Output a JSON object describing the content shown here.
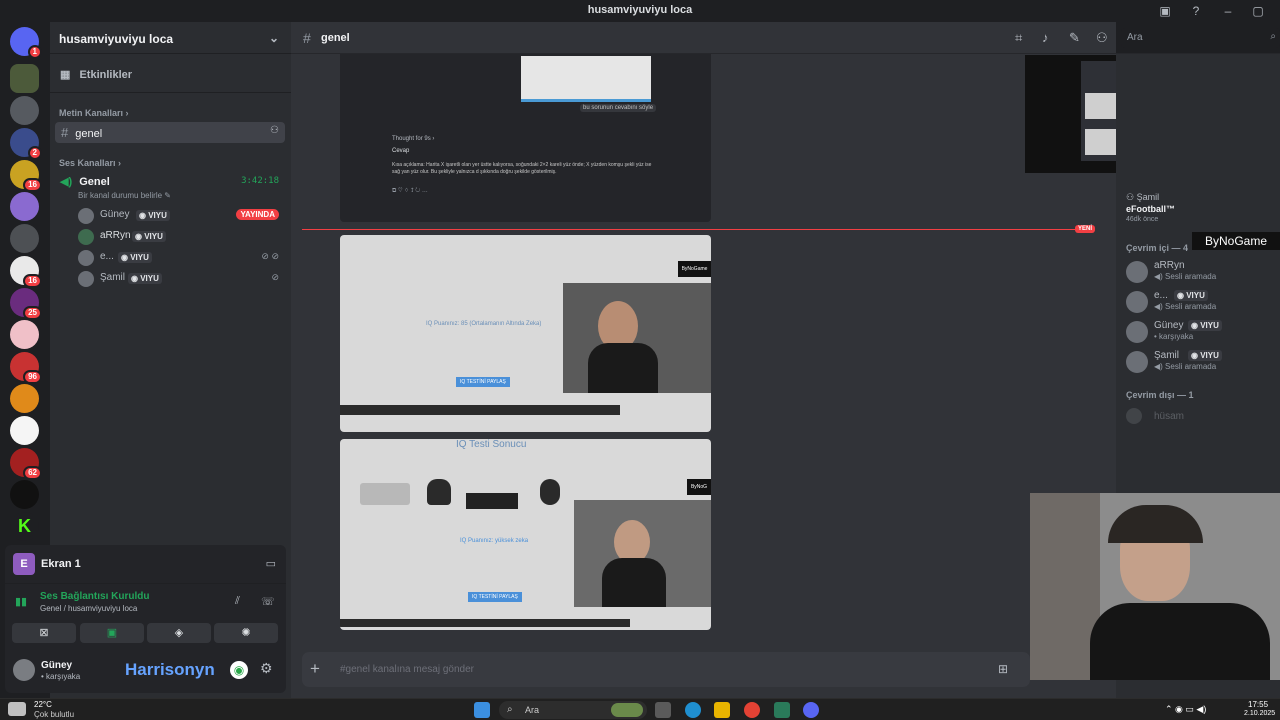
{
  "window": {
    "title": "husamviyuviyu loca"
  },
  "server": {
    "name": "husamviyuviyu loca",
    "events_label": "Etkinlikler",
    "text_category": "Metin Kanalları",
    "text_channel": "genel",
    "voice_category": "Ses Kanalları",
    "voice_channel": "Genel",
    "voice_timer": "3:42:18",
    "voice_status": "Bir kanal durumu belirle",
    "live_badge": "YAYINDA",
    "voice_users": [
      {
        "name": "Güney",
        "tag": "VIYU",
        "live": true
      },
      {
        "name": "aRRyn",
        "tag": "VIYU"
      },
      {
        "name": "e...",
        "tag": "VIYU"
      },
      {
        "name": "Şamil",
        "tag": "VIYU"
      }
    ]
  },
  "voice_panel": {
    "stream_label": "Ekran 1",
    "connection_status": "Ses Bağlantısı Kuruldu",
    "connection_detail": "Genel / husamviyuviyu loca",
    "user_name": "Güney",
    "user_status": "• karşıyaka",
    "overlay_name": "Harrisonyn"
  },
  "channel": {
    "name": "genel",
    "search_placeholder": "Ara",
    "new_label": "YENİ",
    "input_placeholder": "#genel kanalına mesaj gönder"
  },
  "message_card": {
    "image_caption": "bu sorunun cevabını söyle",
    "thought": "Thought for 9s ›",
    "reply_label": "Cevap",
    "body": "Kısa açıklama: Harita X işaretli olan yer üstte kalıyorsa, soğundaki 2×2 kareli yüz önde; X yüzden komşu şekli yüz ise sağ yan yüz olur. Bu şekliyle yalnızca d şıkkında doğru şekilde gösterilmiş."
  },
  "screens": {
    "first_watermark": "ByNoGame",
    "first_text": "IQ Puanınız: 85 (Ortalamanın Altında Zeka)",
    "first_button": "IQ TESTİNİ PAYLAŞ",
    "second_title": "IQ Testi Sonucu",
    "second_text": "IQ Puanınız: yüksek zeka",
    "second_button": "IQ TESTİNİ PAYLAŞ",
    "second_watermark": "ByNoG"
  },
  "members": {
    "activity_user": "Şamil",
    "activity_game": "eFootball™",
    "activity_time": "46dk önce",
    "online_header": "Çevrim içi — 4",
    "online": [
      {
        "name": "aRRyn",
        "status": "Sesli aramada"
      },
      {
        "name": "e...",
        "tag": "VIYU",
        "status": "Sesli aramada"
      },
      {
        "name": "Güney",
        "tag": "VIYU",
        "status": "• karşıyaka"
      },
      {
        "name": "Şamil",
        "tag": "VIYU",
        "status": "Sesli aramada"
      }
    ],
    "offline_header": "Çevrim dışı — 1",
    "offline": [
      {
        "name": "hüsam"
      }
    ],
    "bynogame": "ByNoGame"
  },
  "taskbar": {
    "weather_temp": "22°C",
    "weather_desc": "Çok bulutlu",
    "search_label": "Ara",
    "time": "17:55",
    "date": "2.10.2025"
  },
  "colors": {
    "accent_green": "#23a55a",
    "live_red": "#f23f43",
    "blurple": "#5865f2"
  }
}
